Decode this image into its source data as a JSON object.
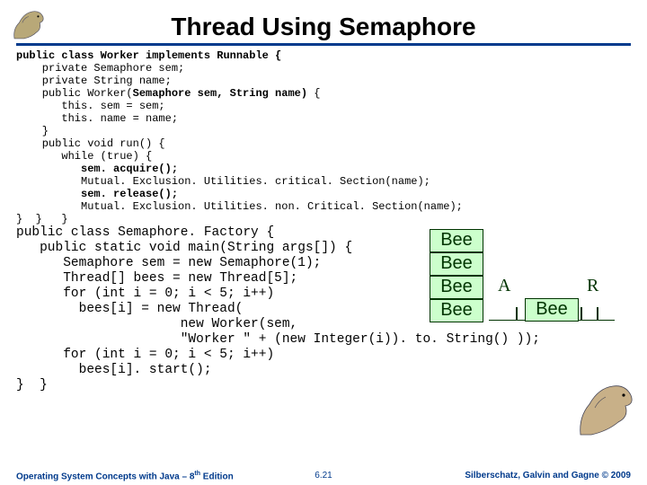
{
  "title": "Thread Using Semaphore",
  "code1": {
    "l1a": "public class Worker implements Runnable {",
    "l2": "    private Semaphore sem;",
    "l3": "    private String name;",
    "l4a": "    public Worker(",
    "l4b": "Semaphore sem, String name)",
    "l4c": " {",
    "l5": "       this. sem = sem;",
    "l6": "       this. name = name;",
    "l7": "    }",
    "l8": "    public void run() {",
    "l9": "       while (true) {",
    "l10a": "          ",
    "l10b": "sem. acquire();",
    "l11": "          Mutual. Exclusion. Utilities. critical. Section(name);",
    "l12a": "          ",
    "l12b": "sem. release();",
    "l13": "          Mutual. Exclusion. Utilities. non. Critical. Section(name);",
    "l14": "}  }   }"
  },
  "code2": {
    "l1": "public class Semaphore. Factory {",
    "l2": "   public static void main(String args[]) {",
    "l3": "      Semaphore sem = new Semaphore(1);",
    "l4": "      Thread[] bees = new Thread[5];",
    "l5": "      for (int i = 0; i < 5; i++)",
    "l6": "        bees[i] = new Thread(",
    "l7": "                     new Worker(sem,",
    "l8": "                     \"Worker \" + (new Integer(i)). to. String() ));",
    "l9": "      for (int i = 0; i < 5; i++)",
    "l10": "        bees[i]. start();",
    "l11": "}  }"
  },
  "boxes": {
    "b1": "Bee",
    "b2": "Bee",
    "b3": "Bee",
    "b4": "Bee",
    "b5": "Bee"
  },
  "labels": {
    "A": "A",
    "R": "R"
  },
  "footer": {
    "left": "Operating System Concepts with Java – 8",
    "left_sup": "th",
    "left2": " Edition",
    "center": "6.21",
    "right": "Silberschatz, Galvin and Gagne © 2009"
  }
}
